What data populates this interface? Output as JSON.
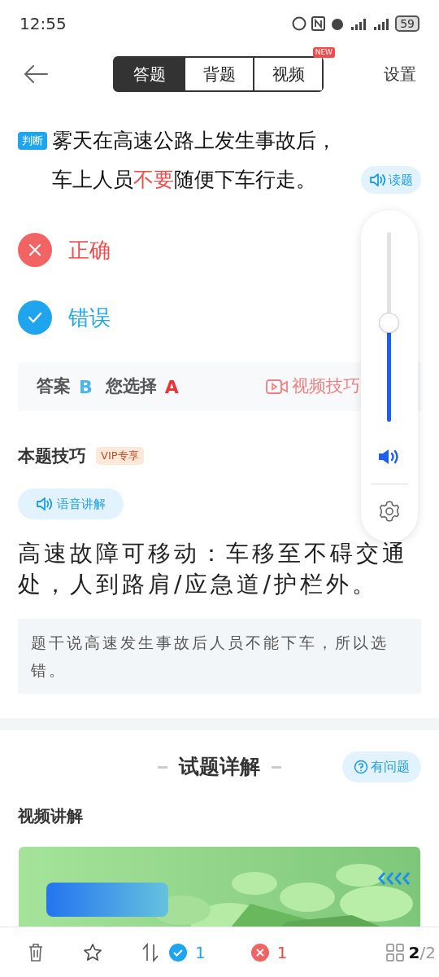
{
  "status_bar": {
    "time": "12:55",
    "battery": "59"
  },
  "header": {
    "tabs": [
      {
        "label": "答题",
        "selected": true
      },
      {
        "label": "背题",
        "selected": false
      },
      {
        "label": "视频",
        "selected": false,
        "badge": "NEW"
      }
    ],
    "settings": "设置"
  },
  "question": {
    "type_tag": "判断",
    "segments": [
      {
        "text": "雾天在高速公路上发生事故后，车上人员",
        "highlight": false
      },
      {
        "text": "不要",
        "highlight": true
      },
      {
        "text": "随便下车行走。",
        "highlight": false
      }
    ],
    "read_button": "读题"
  },
  "options": [
    {
      "label": "正确",
      "correct": false
    },
    {
      "label": "错误",
      "correct": true
    }
  ],
  "answer_bar": {
    "answer_label": "答案",
    "answer": "B",
    "choice_label": "您选择",
    "choice": "A",
    "video_tip": "视频技巧"
  },
  "volume_popup": {
    "level": 0.52
  },
  "tip": {
    "title": "本题技巧",
    "vip_badge": "VIP专享",
    "voice_button": "语音讲解",
    "summary": "高速故障可移动：车移至不碍交通处，人到路肩/应急道/护栏外。",
    "note": "题干说高速发生事故后人员不能下车，所以选错。"
  },
  "explanation": {
    "title": "试题详解",
    "question_button": "有问题",
    "video_heading": "视频讲解"
  },
  "bottom_bar": {
    "correct_count": "1",
    "wrong_count": "1",
    "current": "2",
    "total": "/2"
  }
}
